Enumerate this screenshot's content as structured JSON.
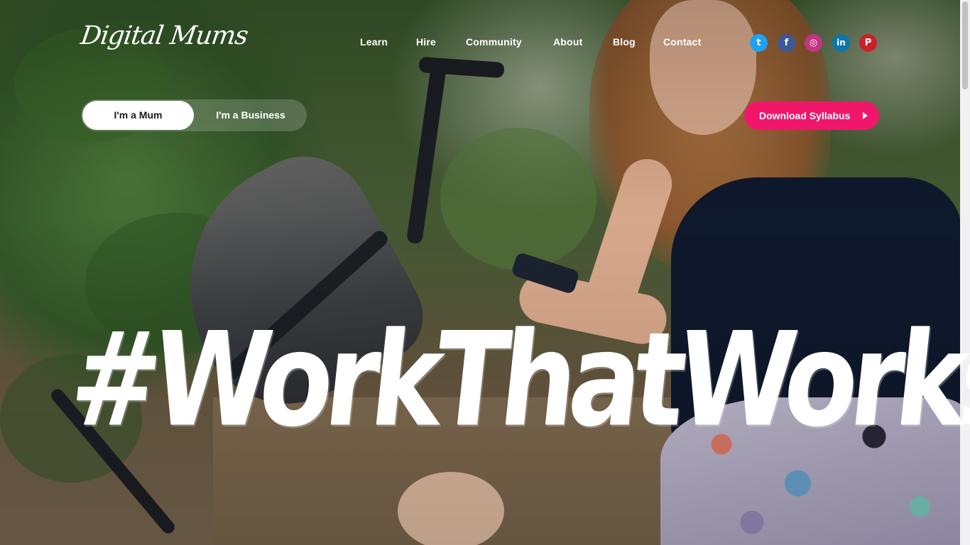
{
  "brand": {
    "logo_text": "Digital Mums"
  },
  "nav": {
    "items": [
      {
        "label": "Learn"
      },
      {
        "label": "Hire"
      },
      {
        "label": "Community"
      },
      {
        "label": "About"
      },
      {
        "label": "Blog"
      },
      {
        "label": "Contact"
      }
    ]
  },
  "social": [
    {
      "icon": "twitter-icon",
      "glyph": "t",
      "color": "#1da1f2"
    },
    {
      "icon": "facebook-icon",
      "glyph": "f",
      "color": "#3b5998"
    },
    {
      "icon": "instagram-icon",
      "glyph": "◎",
      "color": "#c13584"
    },
    {
      "icon": "linkedin-icon",
      "glyph": "in",
      "color": "#0e76a8"
    },
    {
      "icon": "pinterest-icon",
      "glyph": "P",
      "color": "#cb2027"
    }
  ],
  "audience_toggle": {
    "mum_label": "I'm a Mum",
    "business_label": "I'm a Business",
    "selected": "mum"
  },
  "cta": {
    "download_label": "Download Syllabus",
    "color": "#f0176b"
  },
  "hero": {
    "headline": "#WorkThatWorks"
  }
}
